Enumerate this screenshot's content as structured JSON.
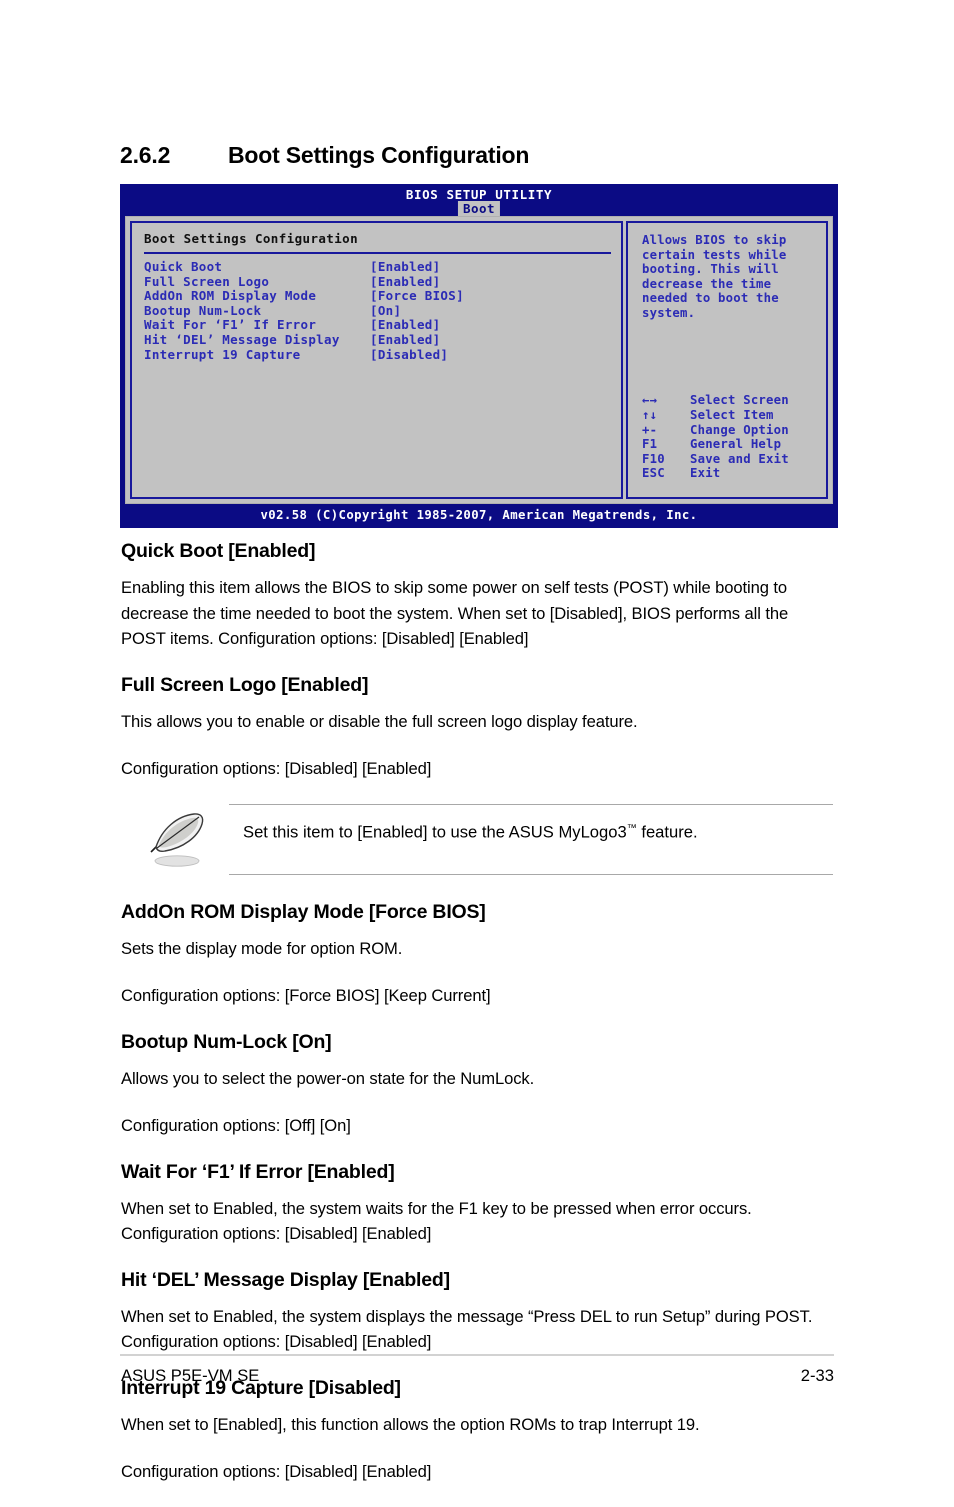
{
  "section": {
    "number": "2.6.2",
    "title": "Boot Settings Configuration"
  },
  "bios": {
    "title": "BIOS SETUP UTILITY",
    "active_tab": "Boot",
    "panel_title": "Boot Settings Configuration",
    "options": [
      {
        "name": "Quick Boot",
        "value": "[Enabled]"
      },
      {
        "name": "Full Screen Logo",
        "value": "[Enabled]"
      },
      {
        "name": "AddOn ROM Display Mode",
        "value": "[Force BIOS]"
      },
      {
        "name": "Bootup Num-Lock",
        "value": "[On]"
      },
      {
        "name": "Wait For ‘F1’ If Error",
        "value": "[Enabled]"
      },
      {
        "name": "Hit ‘DEL’ Message Display",
        "value": "[Enabled]"
      },
      {
        "name": "Interrupt 19 Capture",
        "value": "[Disabled]"
      }
    ],
    "help_text": "Allows BIOS to skip\ncertain tests while\nbooting. This will\ndecrease the time\nneeded to boot the\nsystem.",
    "legend": [
      {
        "key": "←→",
        "label": "Select Screen"
      },
      {
        "key": "↑↓",
        "label": "Select Item"
      },
      {
        "key": "+-",
        "label": "Change Option"
      },
      {
        "key": "F1",
        "label": "General Help"
      },
      {
        "key": "F10",
        "label": "Save and Exit"
      },
      {
        "key": "ESC",
        "label": "Exit"
      }
    ],
    "footer": "v02.58 (C)Copyright 1985-2007, American Megatrends, Inc.",
    "colors": {
      "chrome_blue": "#0b0b84",
      "panel_gray": "#c2c2c2",
      "text_blue": "#2b2bb5",
      "border_blue": "#18189c"
    }
  },
  "items": {
    "quick_boot": {
      "heading": "Quick Boot [Enabled]",
      "body": "Enabling this item allows the BIOS to skip some power on self tests (POST) while booting to decrease the time needed to boot the system. When set to [Disabled], BIOS performs all the POST items. Configuration options: [Disabled] [Enabled]"
    },
    "full_screen_logo": {
      "heading": "Full Screen Logo [Enabled]",
      "body_line1": "This allows you to enable or disable the full screen logo display feature.",
      "body_line2": "Configuration options: [Disabled] [Enabled]"
    },
    "note": {
      "icon": "quill-pen-icon",
      "text_before": "Set this item to [Enabled] to use the ASUS MyLogo3",
      "text_tm": "™",
      "text_after": " feature."
    },
    "addon_rom": {
      "heading": "AddOn ROM Display Mode [Force BIOS]",
      "body_line1": "Sets the display mode for option ROM.",
      "body_line2": "Configuration options: [Force BIOS] [Keep Current]"
    },
    "bootup_numlock": {
      "heading": "Bootup Num-Lock [On]",
      "body_line1": "Allows you to select the power-on state for the NumLock.",
      "body_line2": "Configuration options: [Off] [On]"
    },
    "wait_f1": {
      "heading": "Wait For ‘F1’ If Error [Enabled]",
      "body": "When set to Enabled, the system waits for the F1 key to be pressed when error occurs. Configuration options: [Disabled] [Enabled]"
    },
    "hit_del": {
      "heading": "Hit ‘DEL’ Message Display [Enabled]",
      "body": "When set to Enabled, the system displays the message “Press DEL to run Setup” during POST. Configuration options: [Disabled] [Enabled]"
    },
    "interrupt19": {
      "heading": "Interrupt 19 Capture [Disabled]",
      "body_line1": "When set to [Enabled], this function allows the option ROMs to trap Interrupt 19.",
      "body_line2": "Configuration options: [Disabled] [Enabled]"
    }
  },
  "footer": {
    "left": "ASUS P5E-VM SE",
    "right": "2-33"
  }
}
